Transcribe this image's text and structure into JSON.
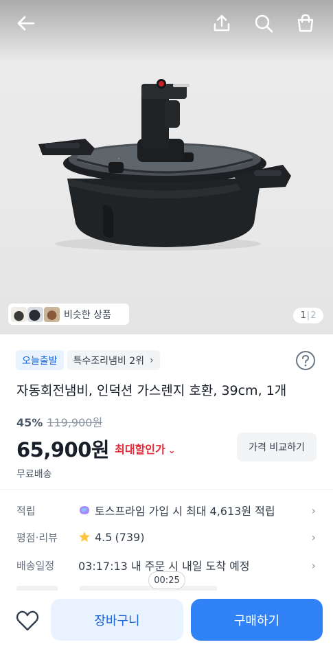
{
  "header": {
    "back_icon": "arrow-left-icon",
    "share_icon": "share-icon",
    "search_icon": "search-icon",
    "cart_icon": "shopping-bag-icon"
  },
  "gallery": {
    "similar_label": "비슷한 상품",
    "page_current": "1",
    "page_separator": "|",
    "page_total": "2"
  },
  "product": {
    "badge_today": "오늘출발",
    "badge_rank": "특수조리냄비 2위",
    "badge_rank_chevron": "›",
    "title": "자동회전냄비, 인덕션 가스렌지 호환, 39cm, 1개",
    "discount_percent": "45%",
    "original_price": "119,900원",
    "price": "65,900원",
    "max_discount_label": "최대할인가",
    "max_discount_chevron": "⌄",
    "compare_button": "가격 비교하기",
    "shipping": "무료배송"
  },
  "info_rows": [
    {
      "label": "적립",
      "value": "토스프라임 가입 시 최대 4,613원 적립",
      "icon": "toss-prime-icon",
      "chevron": "›"
    },
    {
      "label": "평점·리뷰",
      "rating": "4.5",
      "review_count": "(739)",
      "icon": "star-icon",
      "chevron": "›"
    },
    {
      "label": "배송일정",
      "value": "03:17:13 내 주문 시 내일 도착 예정",
      "chevron": "›"
    }
  ],
  "timer": "00:25",
  "bottom": {
    "wishlist_icon": "heart-icon",
    "cart_button": "장바구니",
    "buy_button": "구매하기"
  },
  "colors": {
    "primary": "#3182f6",
    "primary_light": "#e8f3ff",
    "discount_red": "#e42939",
    "star": "#ffc342"
  }
}
